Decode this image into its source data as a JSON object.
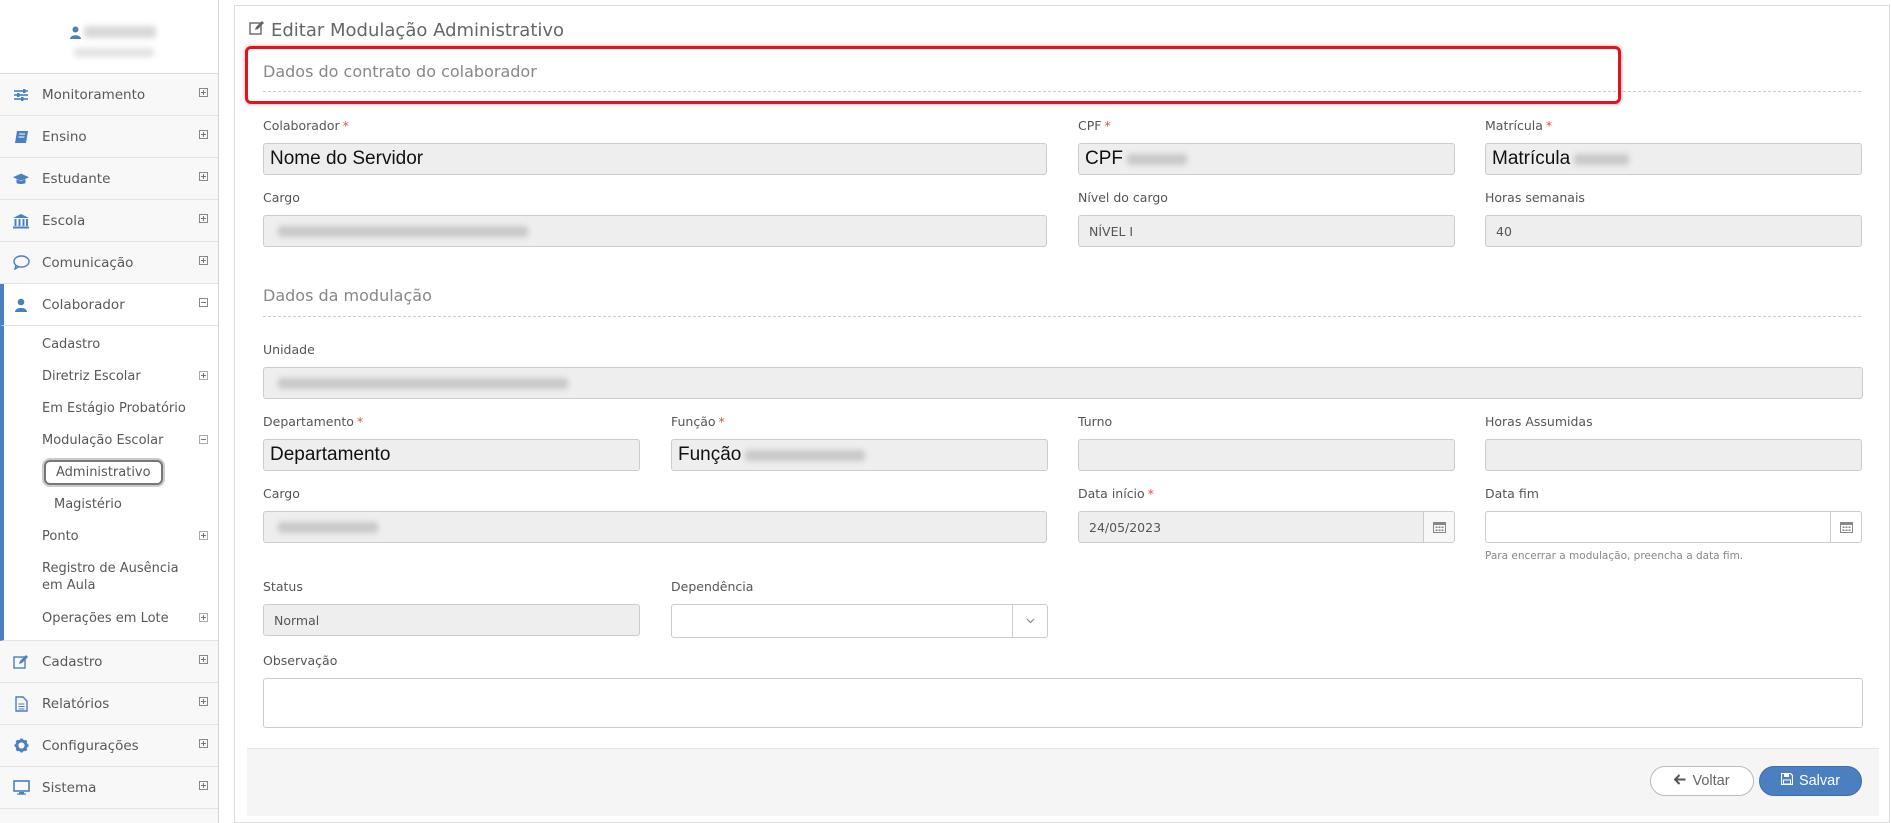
{
  "sidebar": {
    "menu_top": [
      {
        "label": "Monitoramento",
        "icon": "sliders-icon"
      },
      {
        "label": "Ensino",
        "icon": "book-icon"
      },
      {
        "label": "Estudante",
        "icon": "graduation-cap-icon"
      },
      {
        "label": "Escola",
        "icon": "bank-icon"
      },
      {
        "label": "Comunicação",
        "icon": "chat-bubble-icon"
      },
      {
        "label": "Colaborador",
        "icon": "user-icon"
      }
    ],
    "colaborador_sub": [
      {
        "label": "Cadastro"
      },
      {
        "label": "Diretriz Escolar"
      },
      {
        "label": "Em Estágio Probatório"
      },
      {
        "label": "Modulação Escolar"
      },
      {
        "label": "Administrativo"
      },
      {
        "label": "Magistério"
      },
      {
        "label": "Ponto"
      },
      {
        "label": "Registro de Ausência em Aula"
      },
      {
        "label": "Operações em Lote"
      }
    ],
    "menu_bottom": [
      {
        "label": "Cadastro",
        "icon": "edit-icon"
      },
      {
        "label": "Relatórios",
        "icon": "document-icon"
      },
      {
        "label": "Configurações",
        "icon": "gear-icon"
      },
      {
        "label": "Sistema",
        "icon": "monitor-icon"
      }
    ],
    "accent": "#4a7fc0"
  },
  "page": {
    "title": "Editar Modulação Administrativo",
    "section1": "Dados do contrato do colaborador",
    "section2": "Dados da modulação"
  },
  "contrato": {
    "colaborador": {
      "label": "Colaborador",
      "value": "Nome do Servidor"
    },
    "cpf": {
      "label": "CPF",
      "value": "CPF"
    },
    "matricula": {
      "label": "Matrícula",
      "value": "Matrícula"
    },
    "cargo": {
      "label": "Cargo",
      "value": ""
    },
    "nivel": {
      "label": "Nível do cargo",
      "value": "NÍVEL I"
    },
    "horas": {
      "label": "Horas semanais",
      "value": "40"
    }
  },
  "modulacao": {
    "unidade": {
      "label": "Unidade",
      "value": ""
    },
    "departamento": {
      "label": "Departamento",
      "value": "Departamento"
    },
    "funcao": {
      "label": "Função",
      "value": "Função"
    },
    "turno": {
      "label": "Turno",
      "value": ""
    },
    "horas_assumidas": {
      "label": "Horas Assumidas",
      "value": ""
    },
    "cargo": {
      "label": "Cargo",
      "value": ""
    },
    "data_inicio": {
      "label": "Data início",
      "value": "24/05/2023"
    },
    "data_fim": {
      "label": "Data fim",
      "value": ""
    },
    "data_fim_hint": "Para encerrar a modulação, preencha a data fim.",
    "status": {
      "label": "Status",
      "value": "Normal"
    },
    "dependencia": {
      "label": "Dependência",
      "value": ""
    },
    "observacao": {
      "label": "Observação",
      "value": ""
    }
  },
  "actions": {
    "back_label": "Voltar",
    "save_label": "Salvar",
    "save_color": "#4a7fc0"
  },
  "highlight_color": "#e0141e"
}
